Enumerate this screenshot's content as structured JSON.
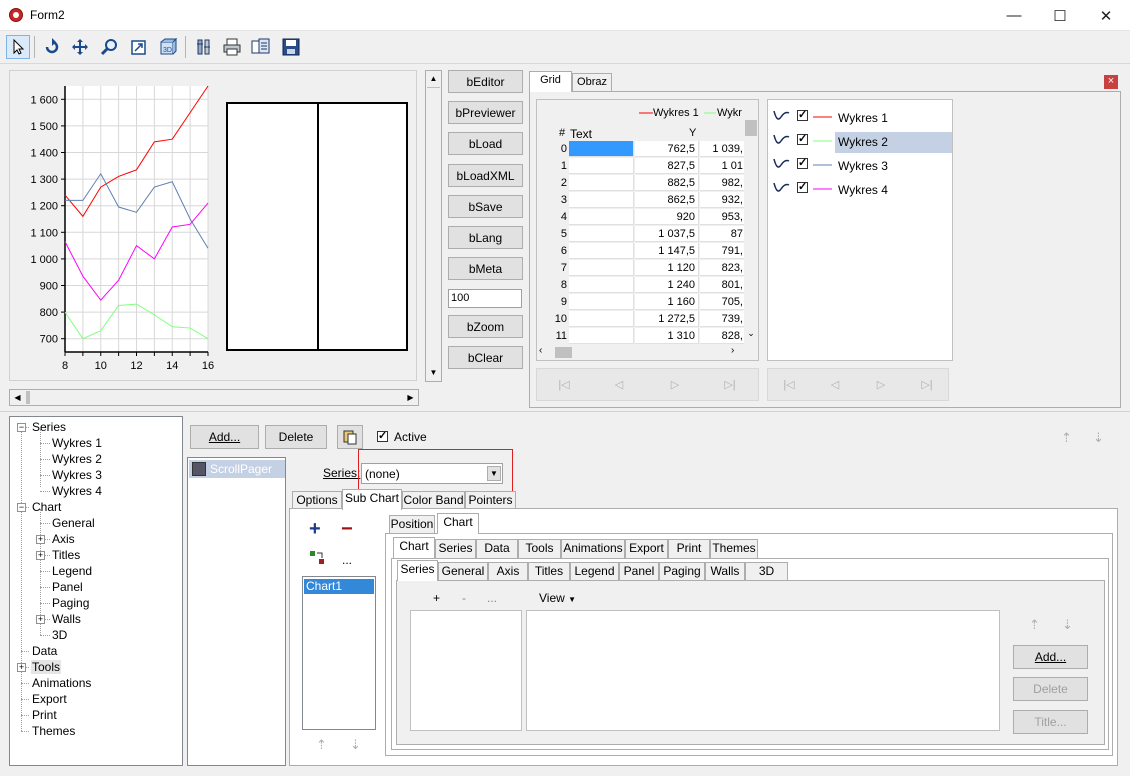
{
  "window": {
    "title": "Form2",
    "minimize": "—",
    "maximize": "☐",
    "close": "✕"
  },
  "toolbar": {
    "icons": [
      "pointer-icon",
      "rotate-icon",
      "move-icon",
      "zoom-icon",
      "depth-icon",
      "3d-icon",
      "edit-tools-icon",
      "print-icon",
      "export-icon",
      "save-icon"
    ]
  },
  "chart": {
    "chart_data": {
      "type": "line",
      "x": [
        8,
        9,
        10,
        11,
        12,
        13,
        14,
        15,
        16
      ],
      "xticks": [
        "8",
        "10",
        "12",
        "14",
        "16"
      ],
      "yticks": [
        "1 600",
        "1 500",
        "1 400",
        "1 300",
        "1 200",
        "1 100",
        "1 000",
        "900",
        "800",
        "700"
      ],
      "ylim": [
        650,
        1650
      ],
      "xlim": [
        8,
        16
      ],
      "grid": true,
      "series": [
        {
          "name": "Wykres 1",
          "color": "#ff0000",
          "values": [
            1240,
            1160,
            1270,
            1310,
            1335,
            1440,
            1450,
            1550,
            1650
          ]
        },
        {
          "name": "Wykres 2",
          "color": "#80ff80",
          "values": [
            800,
            700,
            730,
            825,
            830,
            790,
            745,
            740,
            700
          ]
        },
        {
          "name": "Wykres 3",
          "color": "#6080b0",
          "values": [
            1220,
            1220,
            1320,
            1195,
            1175,
            1270,
            1290,
            1150,
            1040
          ]
        },
        {
          "name": "Wykres 4",
          "color": "#ff00ff",
          "values": [
            1065,
            935,
            845,
            920,
            1050,
            1000,
            1120,
            1130,
            1210
          ]
        }
      ]
    }
  },
  "buttons": {
    "beditor": "bEditor",
    "bpreviewer": "bPreviewer",
    "bload": "bLoad",
    "bloadxml": "bLoadXML",
    "bsave": "bSave",
    "blang": "bLang",
    "bmeta": "bMeta",
    "input100": "100",
    "bzoom": "bZoom",
    "bclear": "bClear"
  },
  "righttabs": {
    "grid": "Grid",
    "obraz": "Obraz",
    "close": "×"
  },
  "grid": {
    "legend1": "Wykres 1",
    "legend2": "Wykr",
    "headers": {
      "num": "#",
      "text": "Text",
      "y": "Y"
    },
    "rows": [
      {
        "n": "0",
        "y": "762,5",
        "z": "1 039,"
      },
      {
        "n": "1",
        "y": "827,5",
        "z": "1 01"
      },
      {
        "n": "2",
        "y": "882,5",
        "z": "982,"
      },
      {
        "n": "3",
        "y": "862,5",
        "z": "932,"
      },
      {
        "n": "4",
        "y": "920",
        "z": "953,"
      },
      {
        "n": "5",
        "y": "1 037,5",
        "z": "87"
      },
      {
        "n": "6",
        "y": "1 147,5",
        "z": "791,"
      },
      {
        "n": "7",
        "y": "1 120",
        "z": "823,"
      },
      {
        "n": "8",
        "y": "1 240",
        "z": "801,"
      },
      {
        "n": "9",
        "y": "1 160",
        "z": "705,"
      },
      {
        "n": "10",
        "y": "1 272,5",
        "z": "739,"
      },
      {
        "n": "11",
        "y": "1 310",
        "z": "828,"
      }
    ]
  },
  "serieslist": [
    {
      "name": "Wykres 1",
      "color": "#ff0000"
    },
    {
      "name": "Wykres 2",
      "color": "#80ff80"
    },
    {
      "name": "Wykres 3",
      "color": "#6080b0"
    },
    {
      "name": "Wykres 4",
      "color": "#ff00ff"
    }
  ],
  "tree": {
    "series": "Series",
    "w1": "Wykres 1",
    "w2": "Wykres 2",
    "w3": "Wykres 3",
    "w4": "Wykres 4",
    "chart": "Chart",
    "general": "General",
    "axis": "Axis",
    "titles": "Titles",
    "legend": "Legend",
    "panel": "Panel",
    "paging": "Paging",
    "walls": "Walls",
    "d3": "3D",
    "data": "Data",
    "tools": "Tools",
    "animations": "Animations",
    "export": "Export",
    "print": "Print",
    "themes": "Themes"
  },
  "tools": {
    "add": "Add...",
    "delete": "Delete",
    "active": "Active",
    "toolitem": "ScrollPager"
  },
  "scrollpager": {
    "series_label": "Series:",
    "series_value": "(none)",
    "tabs": [
      "Options",
      "Sub Chart",
      "Color Band",
      "Pointers"
    ],
    "chartitem": "Chart1",
    "plus": "+",
    "minus": "−",
    "dots": "..."
  },
  "subchart": {
    "tabs": [
      "Position",
      "Chart"
    ],
    "tabs2": [
      "Chart",
      "Series",
      "Data",
      "Tools",
      "Animations",
      "Export",
      "Print",
      "Themes"
    ],
    "tabs3": [
      "Series",
      "General",
      "Axis",
      "Titles",
      "Legend",
      "Panel",
      "Paging",
      "Walls",
      "3D"
    ],
    "plus": "+",
    "minus": "-",
    "dots": "...",
    "view": "View",
    "add": "Add...",
    "delete": "Delete",
    "title": "Title..."
  }
}
